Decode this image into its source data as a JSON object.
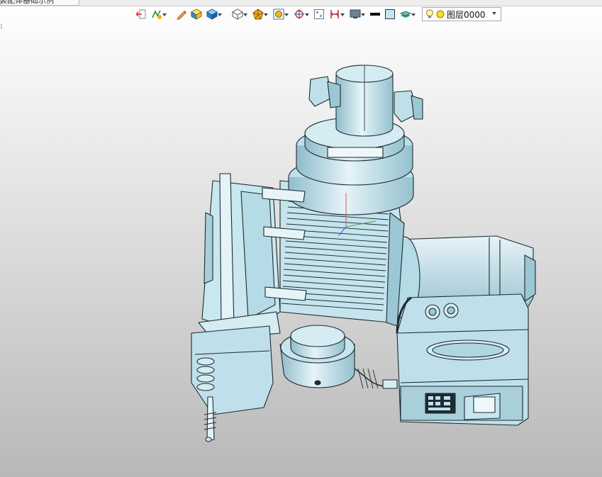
{
  "window": {
    "tab_label": "装配体基础示例"
  },
  "toolbar": {
    "edge_mark": ":",
    "buttons": [
      {
        "name": "exit-sketch-icon"
      },
      {
        "name": "sketch-tools-icon"
      },
      {
        "name": "edit-pencil-icon"
      },
      {
        "name": "cube-yellow-icon"
      },
      {
        "name": "cube-blue-icon"
      },
      {
        "name": "wireframe-cube-icon"
      },
      {
        "name": "render-mode-icon"
      },
      {
        "name": "view-fit-icon"
      },
      {
        "name": "crosshair-icon"
      },
      {
        "name": "grid-icon"
      },
      {
        "name": "dimension-icon"
      },
      {
        "name": "display-monitor-icon"
      },
      {
        "name": "line-style-icon"
      },
      {
        "name": "color-swatch-icon"
      },
      {
        "name": "layer-stack-icon"
      }
    ],
    "layer_combo": {
      "value": "图层0000",
      "icons": [
        "light-bulb-icon",
        "sun-dot-icon"
      ]
    }
  },
  "colors": {
    "part_fill": "#bfe0ea",
    "part_shade": "#9cc7d4",
    "part_light": "#e4f3f7",
    "edge": "#1e2a30",
    "bg_top": "#ffffff",
    "bg_bottom": "#b8b8b8"
  }
}
